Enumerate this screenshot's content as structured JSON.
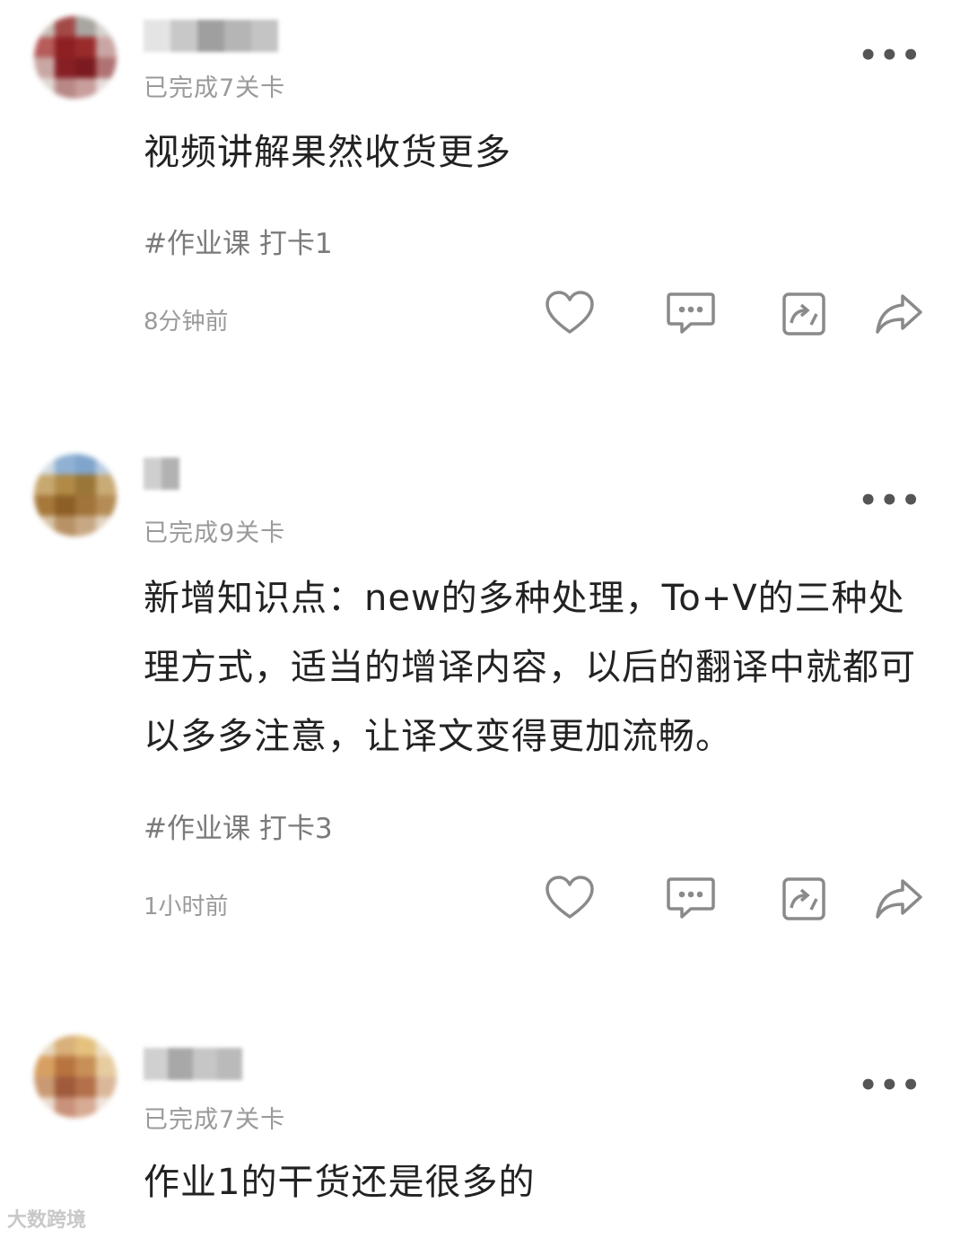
{
  "posts": [
    {
      "progress": "已完成7关卡",
      "content": "视频讲解果然收货更多",
      "tag": "#作业课 打卡1",
      "time": "8分钟前",
      "more": "•••"
    },
    {
      "progress": "已完成9关卡",
      "content": "新增知识点：new的多种处理，To+V的三种处理方式，适当的增译内容，以后的翻译中就都可以多多注意，让译文变得更加流畅。",
      "tag": "#作业课 打卡3",
      "time": "1小时前",
      "more": "•••"
    },
    {
      "progress": "已完成7关卡",
      "content": "作业1的干货还是很多的",
      "more": "•••"
    }
  ],
  "icons": {
    "like": "heart-icon",
    "comment": "comment-icon",
    "repost": "repost-icon",
    "share": "share-icon"
  },
  "watermark": "大数跨境",
  "colors": {
    "text_primary": "#222222",
    "text_secondary": "#9a9a9a",
    "tag": "#7a7a7a",
    "icon": "#8a8a8a"
  }
}
